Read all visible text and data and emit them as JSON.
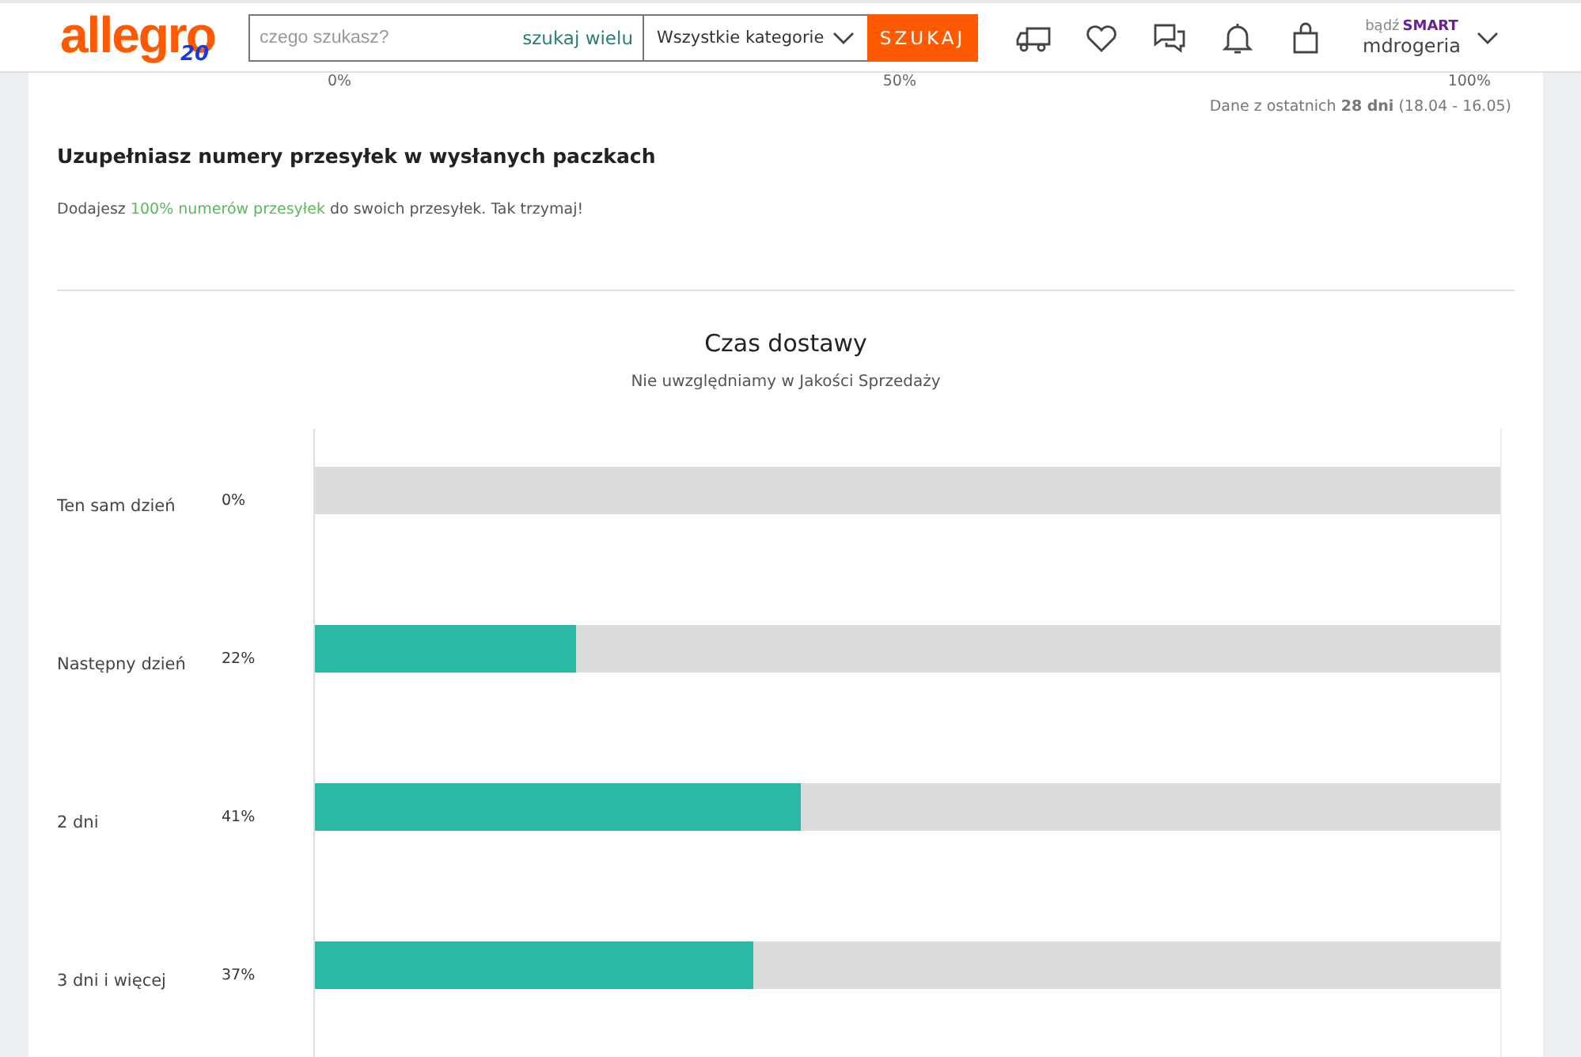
{
  "header": {
    "logo": "allegro",
    "logo_badge": "20",
    "search": {
      "placeholder": "czego szukasz?"
    },
    "search_many": "szukaj wielu",
    "category": "Wszystkie kategorie",
    "search_button": "SZUKAJ",
    "smart_prefix": "bądź",
    "smart": "SMART",
    "user": "mdrogeria"
  },
  "top_axis": {
    "ticks": [
      "0%",
      "50%",
      "100%"
    ]
  },
  "data_range": {
    "prefix": "Dane z ostatnich",
    "days": "28 dni",
    "dates": "(18.04 - 16.05)"
  },
  "tracking": {
    "title": "Uzupełniasz numery przesyłek w wysłanych paczkach",
    "text_before": "Dodajesz",
    "text_highlight": "100% numerów przesyłek",
    "text_after": "do swoich przesyłek. Tak trzymaj!"
  },
  "delivery": {
    "title": "Czas dostawy",
    "subtitle": "Nie uwzględniamy w Jakości Sprzedaży",
    "rows": [
      {
        "label": "Ten sam dzień",
        "value": "0%"
      },
      {
        "label": "Następny dzień",
        "value": "22%",
        "level": 0.22
      },
      {
        "label": "2 dni",
        "value": "41%",
        "level": 0.41
      },
      {
        "label": "3 dni i więcej",
        "value": "37%",
        "level": 0.37
      }
    ]
  }
}
